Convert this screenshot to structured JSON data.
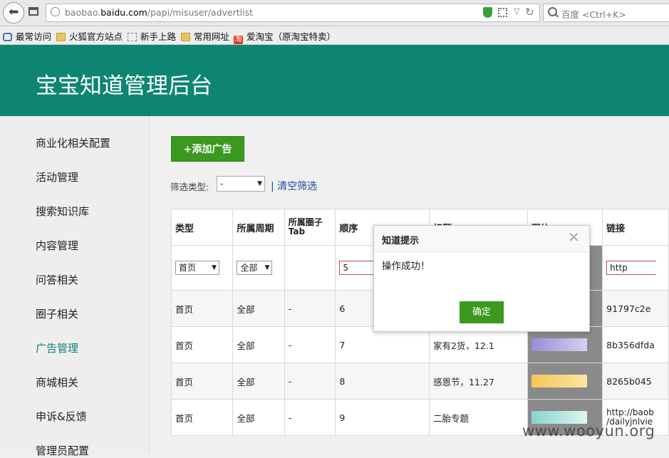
{
  "browser": {
    "url_host_prefix": "baobao.",
    "url_host_main": "baidu.com",
    "url_path": "/papi/misuser/advertlist",
    "search_placeholder": "百度 <Ctrl+K>"
  },
  "bookmarks": [
    {
      "label": "最常访问",
      "icon": "bookmark-search-icon"
    },
    {
      "label": "火狐官方站点",
      "icon": "folder-icon"
    },
    {
      "label": "新手上路",
      "icon": "page-icon"
    },
    {
      "label": "常用网址",
      "icon": "folder-icon"
    },
    {
      "label": "爱淘宝（原淘宝特卖）",
      "icon": "taobao-icon"
    }
  ],
  "header": {
    "title": "宝宝知道管理后台",
    "color": "#0e8571"
  },
  "sidebar": {
    "items": [
      {
        "label": "商业化相关配置"
      },
      {
        "label": "活动管理"
      },
      {
        "label": "搜索知识库"
      },
      {
        "label": "内容管理"
      },
      {
        "label": "问答相关"
      },
      {
        "label": "圈子相关"
      },
      {
        "label": "广告管理",
        "active": true
      },
      {
        "label": "商城相关"
      },
      {
        "label": "申诉&反馈"
      },
      {
        "label": "管理员配置"
      }
    ]
  },
  "main": {
    "add_button": "+添加广告",
    "filter_label": "筛选类型:",
    "filter_value": "-",
    "clear_link": "| 清空筛选"
  },
  "table": {
    "headers": {
      "type": "类型",
      "period": "所属周期",
      "circle": "所属圈子",
      "circle_sub": "Tab",
      "order": "顺序",
      "title": "标题",
      "image": "图片",
      "link": "链接"
    },
    "edit_row": {
      "type": "首页",
      "period": "全部",
      "order": "5",
      "upload": "图片",
      "link": "http"
    },
    "rows": [
      {
        "type": "首页",
        "period": "全部",
        "circle": "-",
        "order": "6",
        "title": "",
        "banner": "b-blue",
        "link": "91797c2e"
      },
      {
        "type": "首页",
        "period": "全部",
        "circle": "-",
        "order": "7",
        "title": "家有2货，12.1",
        "banner": "b-purple",
        "link": "8b356dfda"
      },
      {
        "type": "首页",
        "period": "全部",
        "circle": "-",
        "order": "8",
        "title": "感恩节，11.27",
        "banner": "b-yellow",
        "link": "8265b045"
      },
      {
        "type": "首页",
        "period": "全部",
        "circle": "-",
        "order": "9",
        "title": "二胎专题",
        "banner": "b-teal",
        "link": "http://baob",
        "link2": "/dailyjnlvie"
      }
    ]
  },
  "dialog": {
    "title": "知道提示",
    "message": "操作成功！",
    "ok": "确定"
  },
  "watermark": "www.wooyun.org"
}
